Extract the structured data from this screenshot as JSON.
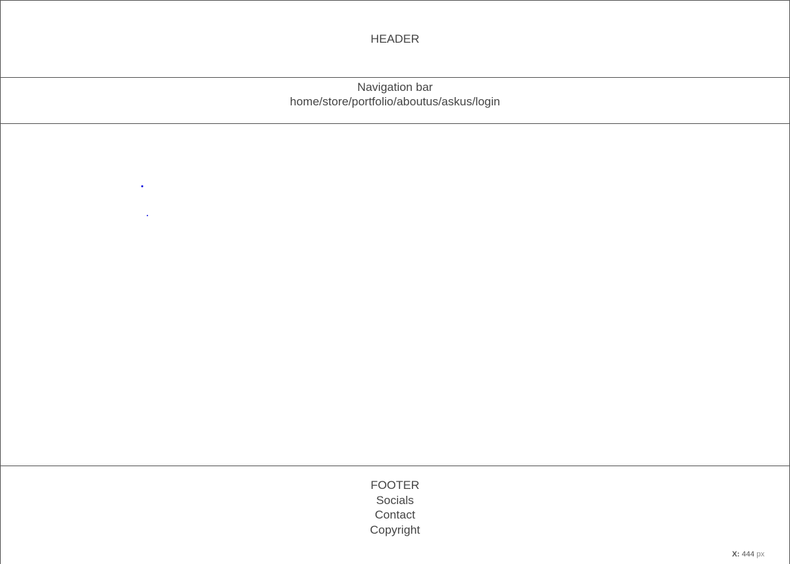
{
  "header": {
    "title": "HEADER"
  },
  "nav": {
    "title": "Navigation bar",
    "links": "home/store/portfolio/aboutus/askus/login"
  },
  "footer": {
    "title": "FOOTER",
    "lines": [
      "Socials",
      "Contact",
      "Copyright"
    ]
  },
  "coordinate_readout": {
    "label": "X:",
    "value": "444",
    "unit": "px"
  },
  "colors": {
    "border": "#555555",
    "text": "#444444",
    "dot": "#1a1adf"
  }
}
